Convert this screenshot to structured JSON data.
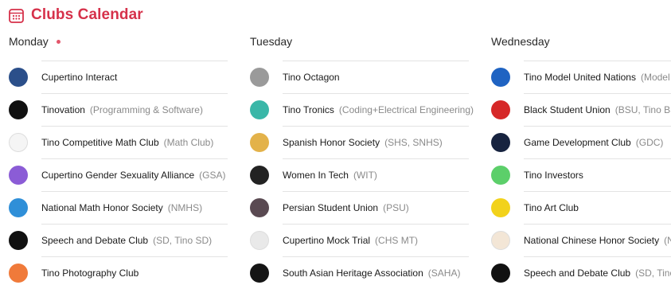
{
  "header": {
    "title": "Clubs Calendar",
    "icon": "calendar-icon",
    "accent": "#d6314a"
  },
  "days": [
    {
      "label": "Monday",
      "today": true,
      "clubs": [
        {
          "name": "Cupertino Interact",
          "alias": "",
          "logo_color": "#2b4f8a",
          "logo_text": ""
        },
        {
          "name": "Tinovation",
          "alias": "(Programming & Software)",
          "logo_color": "#111111",
          "logo_text": ""
        },
        {
          "name": "Tino Competitive Math Club",
          "alias": "(Math Club)",
          "logo_color": "#f5f5f5",
          "logo_text": ""
        },
        {
          "name": "Cupertino Gender Sexuality Alliance",
          "alias": "(GSA)",
          "logo_color": "#8b5cd6",
          "logo_text": ""
        },
        {
          "name": "National Math Honor Society",
          "alias": "(NMHS)",
          "logo_color": "#2f8fd8",
          "logo_text": ""
        },
        {
          "name": "Speech and Debate Club",
          "alias": "(SD, Tino SD)",
          "logo_color": "#111111",
          "logo_text": ""
        },
        {
          "name": "Tino Photography Club",
          "alias": "",
          "logo_color": "#f07a3a",
          "logo_text": ""
        }
      ]
    },
    {
      "label": "Tuesday",
      "today": false,
      "clubs": [
        {
          "name": "Tino Octagon",
          "alias": "",
          "logo_color": "#9a9a9a",
          "logo_text": ""
        },
        {
          "name": "Tino Tronics",
          "alias": "(Coding+Electrical Engineering)",
          "logo_color": "#3ab7a8",
          "logo_text": ""
        },
        {
          "name": "Spanish Honor Society",
          "alias": "(SHS, SNHS)",
          "logo_color": "#e3b24a",
          "logo_text": ""
        },
        {
          "name": "Women In Tech",
          "alias": "(WIT)",
          "logo_color": "#222222",
          "logo_text": ""
        },
        {
          "name": "Persian Student Union",
          "alias": "(PSU)",
          "logo_color": "#5a4a52",
          "logo_text": ""
        },
        {
          "name": "Cupertino Mock Trial",
          "alias": "(CHS MT)",
          "logo_color": "#e9e9e9",
          "logo_text": ""
        },
        {
          "name": "South Asian Heritage Association",
          "alias": "(SAHA)",
          "logo_color": "#151515",
          "logo_text": ""
        }
      ]
    },
    {
      "label": "Wednesday",
      "today": false,
      "clubs": [
        {
          "name": "Tino Model United Nations",
          "alias": "(Model UN,",
          "logo_color": "#1f63c2",
          "logo_text": ""
        },
        {
          "name": "Black Student Union",
          "alias": "(BSU, Tino BSU)",
          "logo_color": "#d62828",
          "logo_text": ""
        },
        {
          "name": "Game Development Club",
          "alias": "(GDC)",
          "logo_color": "#17233f",
          "logo_text": ""
        },
        {
          "name": "Tino Investors",
          "alias": "",
          "logo_color": "#5ccf6a",
          "logo_text": ""
        },
        {
          "name": "Tino Art Club",
          "alias": "",
          "logo_color": "#f2d21b",
          "logo_text": ""
        },
        {
          "name": "National Chinese Honor Society",
          "alias": "(NCHS",
          "logo_color": "#f3e6d6",
          "logo_text": ""
        },
        {
          "name": "Speech and Debate Club",
          "alias": "(SD, Tino SD)",
          "logo_color": "#111111",
          "logo_text": ""
        }
      ]
    }
  ]
}
